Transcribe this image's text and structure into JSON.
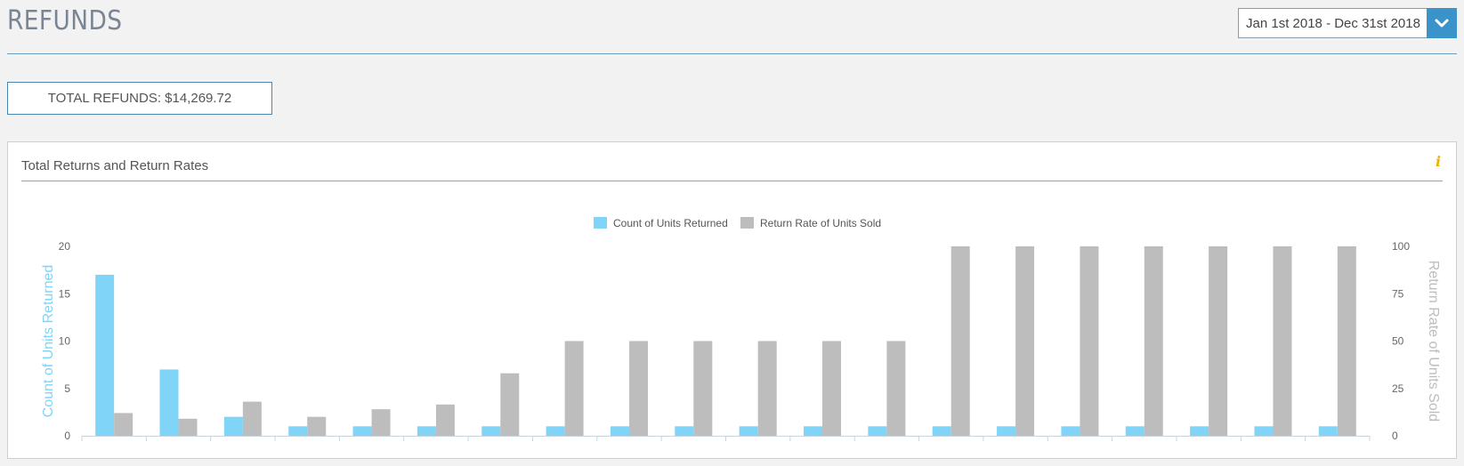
{
  "header": {
    "title": "REFUNDS",
    "date_range": "Jan 1st 2018 - Dec 31st 2018"
  },
  "summary": {
    "total_refunds": "TOTAL REFUNDS: $14,269.72"
  },
  "panel": {
    "title": "Total Returns and Return Rates",
    "info_icon": "i"
  },
  "colors": {
    "returned": "#7fd4f7",
    "rate": "#bdbdbd",
    "accent": "#3a93c9",
    "info": "#e8b400"
  },
  "chart_data": {
    "type": "bar",
    "title": "",
    "legend_position": "top-center",
    "grid": false,
    "categories": [
      "",
      "",
      "",
      "",
      "",
      "",
      "",
      "",
      "",
      "",
      "",
      "",
      "",
      "",
      "",
      "",
      "",
      "",
      "",
      ""
    ],
    "series": [
      {
        "name": "Count of Units Returned",
        "axis": "left",
        "values": [
          17,
          7,
          2,
          1,
          1,
          1,
          1,
          1,
          1,
          1,
          1,
          1,
          1,
          1,
          1,
          1,
          1,
          1,
          1,
          1
        ]
      },
      {
        "name": "Return Rate of Units Sold",
        "axis": "right",
        "values": [
          12,
          9,
          18,
          10,
          14,
          16.5,
          33,
          50,
          50,
          50,
          50,
          50,
          50,
          100,
          100,
          100,
          100,
          100,
          100,
          100
        ]
      }
    ],
    "y_left": {
      "label": "Count of Units Returned",
      "range": [
        0,
        20
      ],
      "ticks": [
        "0",
        "5",
        "10",
        "15",
        "20"
      ]
    },
    "y_right": {
      "label": "Return Rate of Units Sold",
      "range": [
        0,
        100
      ],
      "ticks": [
        "0",
        "25",
        "50",
        "75",
        "100"
      ]
    }
  }
}
